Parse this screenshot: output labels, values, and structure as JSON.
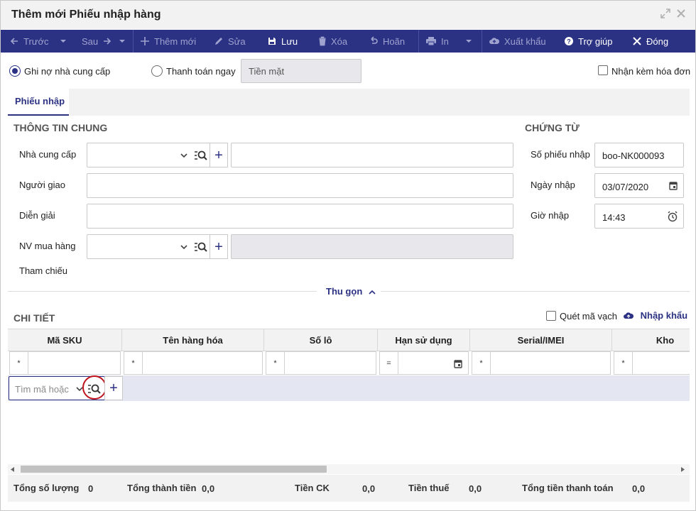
{
  "dialog": {
    "title": "Thêm mới Phiếu nhập hàng",
    "expand_icon": "expand-icon",
    "close_icon": "close-icon"
  },
  "toolbar": {
    "prev_label": "Trước",
    "next_label": "Sau",
    "add_label": "Thêm mới",
    "edit_label": "Sửa",
    "save_label": "Lưu",
    "delete_label": "Xóa",
    "undo_label": "Hoãn",
    "print_label": "In",
    "export_label": "Xuất khẩu",
    "help_label": "Trợ giúp",
    "close_label": "Đóng"
  },
  "payment": {
    "option_credit": "Ghi nợ nhà cung cấp",
    "option_pay_now": "Thanh toán ngay",
    "method_value": "Tiền mặt",
    "receive_invoice_label": "Nhận kèm hóa đơn"
  },
  "tabs": [
    {
      "label": "Phiếu nhập"
    }
  ],
  "general": {
    "section_title": "THÔNG TIN CHUNG",
    "supplier_label": "Nhà cung cấp",
    "deliverer_label": "Người giao",
    "description_label": "Diễn giải",
    "buyer_label": "NV mua hàng",
    "reference_label": "Tham chiếu"
  },
  "voucher": {
    "section_title": "CHỨNG TỪ",
    "number_label": "Số phiếu nhập",
    "number_value": "boo-NK000093",
    "date_label": "Ngày nhập",
    "date_value": "03/07/2020",
    "time_label": "Giờ nhập",
    "time_value": "14:43"
  },
  "collapse_label": "Thu gọn",
  "detail": {
    "section_title": "CHI TIẾT",
    "scan_barcode_label": "Quét mã vạch",
    "import_label": "Nhập khẩu",
    "columns": [
      "Mã SKU",
      "Tên hàng hóa",
      "Số lô",
      "Hạn sử dụng",
      "Serial/IMEI",
      "Kho"
    ],
    "filter_ops": [
      "*",
      "*",
      "*",
      "=",
      "*",
      "*"
    ],
    "search_placeholder": "Tìm mã hoặc"
  },
  "totals": {
    "qty_label": "Tổng số lượng",
    "qty_value": "0",
    "amount_label": "Tổng thành tiền",
    "amount_value": "0,0",
    "discount_label": "Tiền CK",
    "discount_value": "0,0",
    "tax_label": "Tiền thuế",
    "tax_value": "0,0",
    "payment_label": "Tổng tiền thanh toán",
    "payment_value": "0,0"
  },
  "colors": {
    "accent": "#2b3183",
    "highlight_circle": "#c0121c",
    "panel_bg": "#f2f2f2"
  }
}
